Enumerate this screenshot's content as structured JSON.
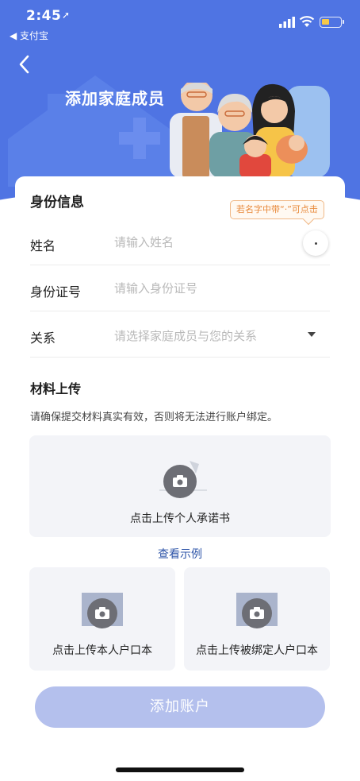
{
  "status_bar": {
    "time": "2:45",
    "back_app": "◀ 支付宝",
    "location_icon": "location-arrow-icon",
    "battery_color": "#f7c948"
  },
  "header": {
    "title": "添加家庭成员",
    "bg_color": "#4f74e3",
    "back_icon": "chevron-left-icon"
  },
  "identity": {
    "section_title": "身份信息",
    "tooltip": "若名字中带“·”可点击",
    "fields": [
      {
        "label": "姓名",
        "placeholder": "请输入姓名",
        "value": ""
      },
      {
        "label": "身份证号",
        "placeholder": "请输入身份证号",
        "value": ""
      },
      {
        "label": "关系",
        "placeholder": "请选择家庭成员与您的关系"
      }
    ]
  },
  "materials": {
    "section_title": "材料上传",
    "hint": "请确保提交材料真实有效，否则将无法进行账户绑定。",
    "upload_main_label": "点击上传个人承诺书",
    "view_example": "查看示例",
    "upload_self_label": "点击上传本人户口本",
    "upload_bound_label": "点击上传被绑定人户口本",
    "upload_icon": "camera-icon"
  },
  "footer": {
    "button_label": "添加账户",
    "button_color": "#b4c0ed"
  }
}
